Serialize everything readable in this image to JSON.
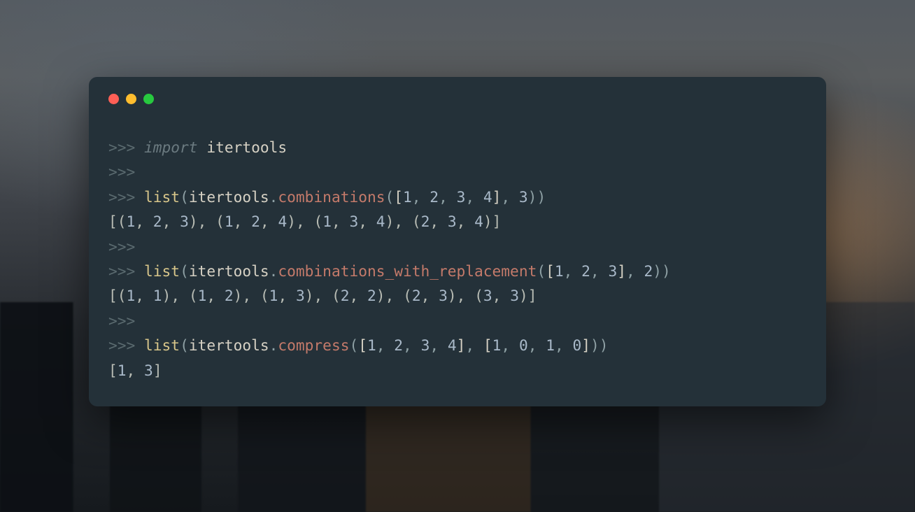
{
  "window": {
    "buttons": [
      "close",
      "minimize",
      "zoom"
    ]
  },
  "colors": {
    "prompt": "#5a6a6f",
    "keyword": "#6b7a80",
    "module": "#d6d1c4",
    "builtin": "#d8c68a",
    "method": "#c47a6a",
    "punct": "#8ea0a4",
    "num": "#a9b9c9",
    "text": "#b8bcb4",
    "bg": "#243139"
  },
  "repl": {
    "prompt": ">>>",
    "lines": [
      {
        "type": "input",
        "tokens": [
          {
            "t": ">>> ",
            "c": "prompt"
          },
          {
            "t": "import ",
            "c": "keyword"
          },
          {
            "t": "itertools",
            "c": "module"
          }
        ]
      },
      {
        "type": "input",
        "tokens": [
          {
            "t": ">>>",
            "c": "prompt"
          }
        ]
      },
      {
        "type": "input",
        "tokens": [
          {
            "t": ">>> ",
            "c": "prompt"
          },
          {
            "t": "list",
            "c": "builtin"
          },
          {
            "t": "(",
            "c": "punct"
          },
          {
            "t": "itertools",
            "c": "ident"
          },
          {
            "t": ".",
            "c": "punct"
          },
          {
            "t": "combinations",
            "c": "method"
          },
          {
            "t": "(",
            "c": "punct"
          },
          {
            "t": "[",
            "c": "bracket"
          },
          {
            "t": "1",
            "c": "num"
          },
          {
            "t": ", ",
            "c": "punct"
          },
          {
            "t": "2",
            "c": "num"
          },
          {
            "t": ", ",
            "c": "punct"
          },
          {
            "t": "3",
            "c": "num"
          },
          {
            "t": ", ",
            "c": "punct"
          },
          {
            "t": "4",
            "c": "num"
          },
          {
            "t": "]",
            "c": "bracket"
          },
          {
            "t": ", ",
            "c": "punct"
          },
          {
            "t": "3",
            "c": "num"
          },
          {
            "t": ")",
            "c": "punct"
          },
          {
            "t": ")",
            "c": "punct"
          }
        ]
      },
      {
        "type": "output",
        "tokens": [
          {
            "t": "[(",
            "c": "text"
          },
          {
            "t": "1",
            "c": "num"
          },
          {
            "t": ", ",
            "c": "text"
          },
          {
            "t": "2",
            "c": "num"
          },
          {
            "t": ", ",
            "c": "text"
          },
          {
            "t": "3",
            "c": "num"
          },
          {
            "t": "), (",
            "c": "text"
          },
          {
            "t": "1",
            "c": "num"
          },
          {
            "t": ", ",
            "c": "text"
          },
          {
            "t": "2",
            "c": "num"
          },
          {
            "t": ", ",
            "c": "text"
          },
          {
            "t": "4",
            "c": "num"
          },
          {
            "t": "), (",
            "c": "text"
          },
          {
            "t": "1",
            "c": "num"
          },
          {
            "t": ", ",
            "c": "text"
          },
          {
            "t": "3",
            "c": "num"
          },
          {
            "t": ", ",
            "c": "text"
          },
          {
            "t": "4",
            "c": "num"
          },
          {
            "t": "), (",
            "c": "text"
          },
          {
            "t": "2",
            "c": "num"
          },
          {
            "t": ", ",
            "c": "text"
          },
          {
            "t": "3",
            "c": "num"
          },
          {
            "t": ", ",
            "c": "text"
          },
          {
            "t": "4",
            "c": "num"
          },
          {
            "t": ")]",
            "c": "text"
          }
        ]
      },
      {
        "type": "input",
        "tokens": [
          {
            "t": ">>>",
            "c": "prompt"
          }
        ]
      },
      {
        "type": "input",
        "tokens": [
          {
            "t": ">>> ",
            "c": "prompt"
          },
          {
            "t": "list",
            "c": "builtin"
          },
          {
            "t": "(",
            "c": "punct"
          },
          {
            "t": "itertools",
            "c": "ident"
          },
          {
            "t": ".",
            "c": "punct"
          },
          {
            "t": "combinations_with_replacement",
            "c": "method"
          },
          {
            "t": "(",
            "c": "punct"
          },
          {
            "t": "[",
            "c": "bracket"
          },
          {
            "t": "1",
            "c": "num"
          },
          {
            "t": ", ",
            "c": "punct"
          },
          {
            "t": "2",
            "c": "num"
          },
          {
            "t": ", ",
            "c": "punct"
          },
          {
            "t": "3",
            "c": "num"
          },
          {
            "t": "]",
            "c": "bracket"
          },
          {
            "t": ", ",
            "c": "punct"
          },
          {
            "t": "2",
            "c": "num"
          },
          {
            "t": ")",
            "c": "punct"
          },
          {
            "t": ")",
            "c": "punct"
          }
        ]
      },
      {
        "type": "output",
        "tokens": [
          {
            "t": "[(",
            "c": "text"
          },
          {
            "t": "1",
            "c": "num"
          },
          {
            "t": ", ",
            "c": "text"
          },
          {
            "t": "1",
            "c": "num"
          },
          {
            "t": "), (",
            "c": "text"
          },
          {
            "t": "1",
            "c": "num"
          },
          {
            "t": ", ",
            "c": "text"
          },
          {
            "t": "2",
            "c": "num"
          },
          {
            "t": "), (",
            "c": "text"
          },
          {
            "t": "1",
            "c": "num"
          },
          {
            "t": ", ",
            "c": "text"
          },
          {
            "t": "3",
            "c": "num"
          },
          {
            "t": "), (",
            "c": "text"
          },
          {
            "t": "2",
            "c": "num"
          },
          {
            "t": ", ",
            "c": "text"
          },
          {
            "t": "2",
            "c": "num"
          },
          {
            "t": "), (",
            "c": "text"
          },
          {
            "t": "2",
            "c": "num"
          },
          {
            "t": ", ",
            "c": "text"
          },
          {
            "t": "3",
            "c": "num"
          },
          {
            "t": "), (",
            "c": "text"
          },
          {
            "t": "3",
            "c": "num"
          },
          {
            "t": ", ",
            "c": "text"
          },
          {
            "t": "3",
            "c": "num"
          },
          {
            "t": ")]",
            "c": "text"
          }
        ]
      },
      {
        "type": "input",
        "tokens": [
          {
            "t": ">>>",
            "c": "prompt"
          }
        ]
      },
      {
        "type": "input",
        "tokens": [
          {
            "t": ">>> ",
            "c": "prompt"
          },
          {
            "t": "list",
            "c": "builtin"
          },
          {
            "t": "(",
            "c": "punct"
          },
          {
            "t": "itertools",
            "c": "ident"
          },
          {
            "t": ".",
            "c": "punct"
          },
          {
            "t": "compress",
            "c": "method"
          },
          {
            "t": "(",
            "c": "punct"
          },
          {
            "t": "[",
            "c": "bracket"
          },
          {
            "t": "1",
            "c": "num"
          },
          {
            "t": ", ",
            "c": "punct"
          },
          {
            "t": "2",
            "c": "num"
          },
          {
            "t": ", ",
            "c": "punct"
          },
          {
            "t": "3",
            "c": "num"
          },
          {
            "t": ", ",
            "c": "punct"
          },
          {
            "t": "4",
            "c": "num"
          },
          {
            "t": "]",
            "c": "bracket"
          },
          {
            "t": ", ",
            "c": "punct"
          },
          {
            "t": "[",
            "c": "bracket"
          },
          {
            "t": "1",
            "c": "num"
          },
          {
            "t": ", ",
            "c": "punct"
          },
          {
            "t": "0",
            "c": "num"
          },
          {
            "t": ", ",
            "c": "punct"
          },
          {
            "t": "1",
            "c": "num"
          },
          {
            "t": ", ",
            "c": "punct"
          },
          {
            "t": "0",
            "c": "num"
          },
          {
            "t": "]",
            "c": "bracket"
          },
          {
            "t": ")",
            "c": "punct"
          },
          {
            "t": ")",
            "c": "punct"
          }
        ]
      },
      {
        "type": "output",
        "tokens": [
          {
            "t": "[",
            "c": "text"
          },
          {
            "t": "1",
            "c": "num"
          },
          {
            "t": ", ",
            "c": "text"
          },
          {
            "t": "3",
            "c": "num"
          },
          {
            "t": "]",
            "c": "text"
          }
        ]
      }
    ]
  }
}
